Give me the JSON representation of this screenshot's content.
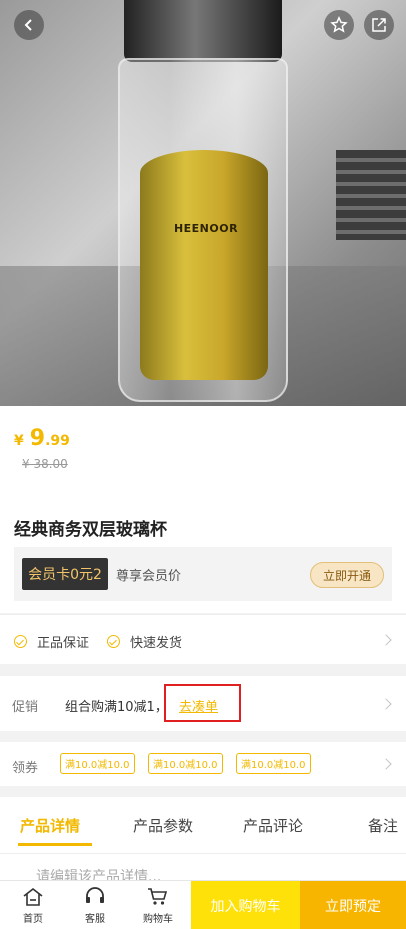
{
  "product": {
    "image_brand_text": "HEENOOR",
    "price_currency": "¥",
    "price_int": "9",
    "price_dec": ".99",
    "original_price": "¥ 38.00",
    "title": "经典商务双层玻璃杯"
  },
  "member": {
    "tag": "会员卡0元2",
    "text": "尊享会员价",
    "button": "立即开通"
  },
  "guarantees": [
    "正品保证",
    "快速发货"
  ],
  "promotion": {
    "label": "促销",
    "text": "组合购满10减1，",
    "link": "去凑单"
  },
  "coupons": {
    "label": "领券",
    "items": [
      "满10.0减10.0",
      "满10.0减10.0",
      "满10.0减10.0"
    ]
  },
  "tabs": [
    "产品详情",
    "产品参数",
    "产品评论",
    "备注"
  ],
  "detail_placeholder": "请编辑该产品详情...",
  "bottom_nav": {
    "home": "首页",
    "service": "客服",
    "cart": "购物车",
    "add_to_cart": "加入购物车",
    "order_now": "立即预定"
  },
  "colors": {
    "accent": "#f2b900",
    "cart_button": "#ffe10a",
    "order_button": "#f7b500",
    "highlight_box": "#e02020"
  },
  "icons": [
    "back-arrow-icon",
    "star-icon",
    "share-icon",
    "check-circle-icon",
    "chevron-right-icon",
    "home-icon",
    "headset-icon",
    "cart-icon"
  ]
}
